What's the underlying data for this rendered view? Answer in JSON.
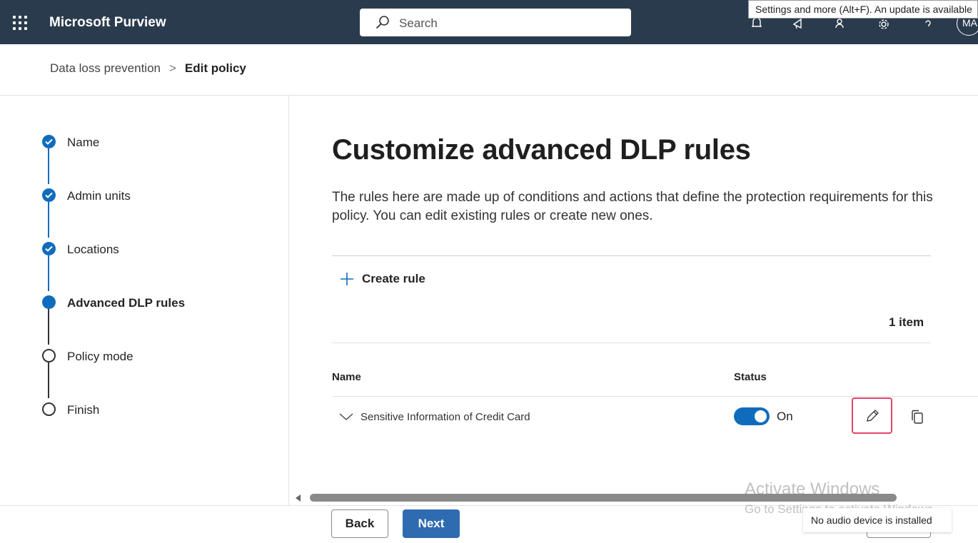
{
  "header": {
    "app_title": "Microsoft Purview",
    "search_placeholder": "Search",
    "avatar_initials": "MA",
    "tooltip": "Settings and more (Alt+F). An update is available"
  },
  "breadcrumb": {
    "parent": "Data loss prevention",
    "separator": ">",
    "current": "Edit policy"
  },
  "steps": [
    {
      "label": "Name",
      "state": "done"
    },
    {
      "label": "Admin units",
      "state": "done"
    },
    {
      "label": "Locations",
      "state": "done"
    },
    {
      "label": "Advanced DLP rules",
      "state": "current"
    },
    {
      "label": "Policy mode",
      "state": "todo"
    },
    {
      "label": "Finish",
      "state": "todo"
    }
  ],
  "main": {
    "title": "Customize advanced DLP rules",
    "description": "The rules here are made up of conditions and actions that define the protection requirements for this policy. You can edit existing rules or create new ones.",
    "create_rule_label": "Create rule",
    "item_count": "1 item",
    "columns": {
      "name": "Name",
      "status": "Status"
    },
    "rows": [
      {
        "name": "Sensitive Information of Credit Card",
        "status": "On",
        "enabled": true
      }
    ]
  },
  "footer": {
    "back_label": "Back",
    "next_label": "Next"
  },
  "overlays": {
    "watermark_title": "Activate Windows",
    "watermark_subtitle": "Go to Settings to activate Windows.",
    "audio_notice": "No audio device is installed"
  },
  "colors": {
    "header_bg": "#2b3b4e",
    "accent": "#0f6cbd",
    "next_button": "#2f6bb0",
    "highlight": "#e5436b"
  }
}
